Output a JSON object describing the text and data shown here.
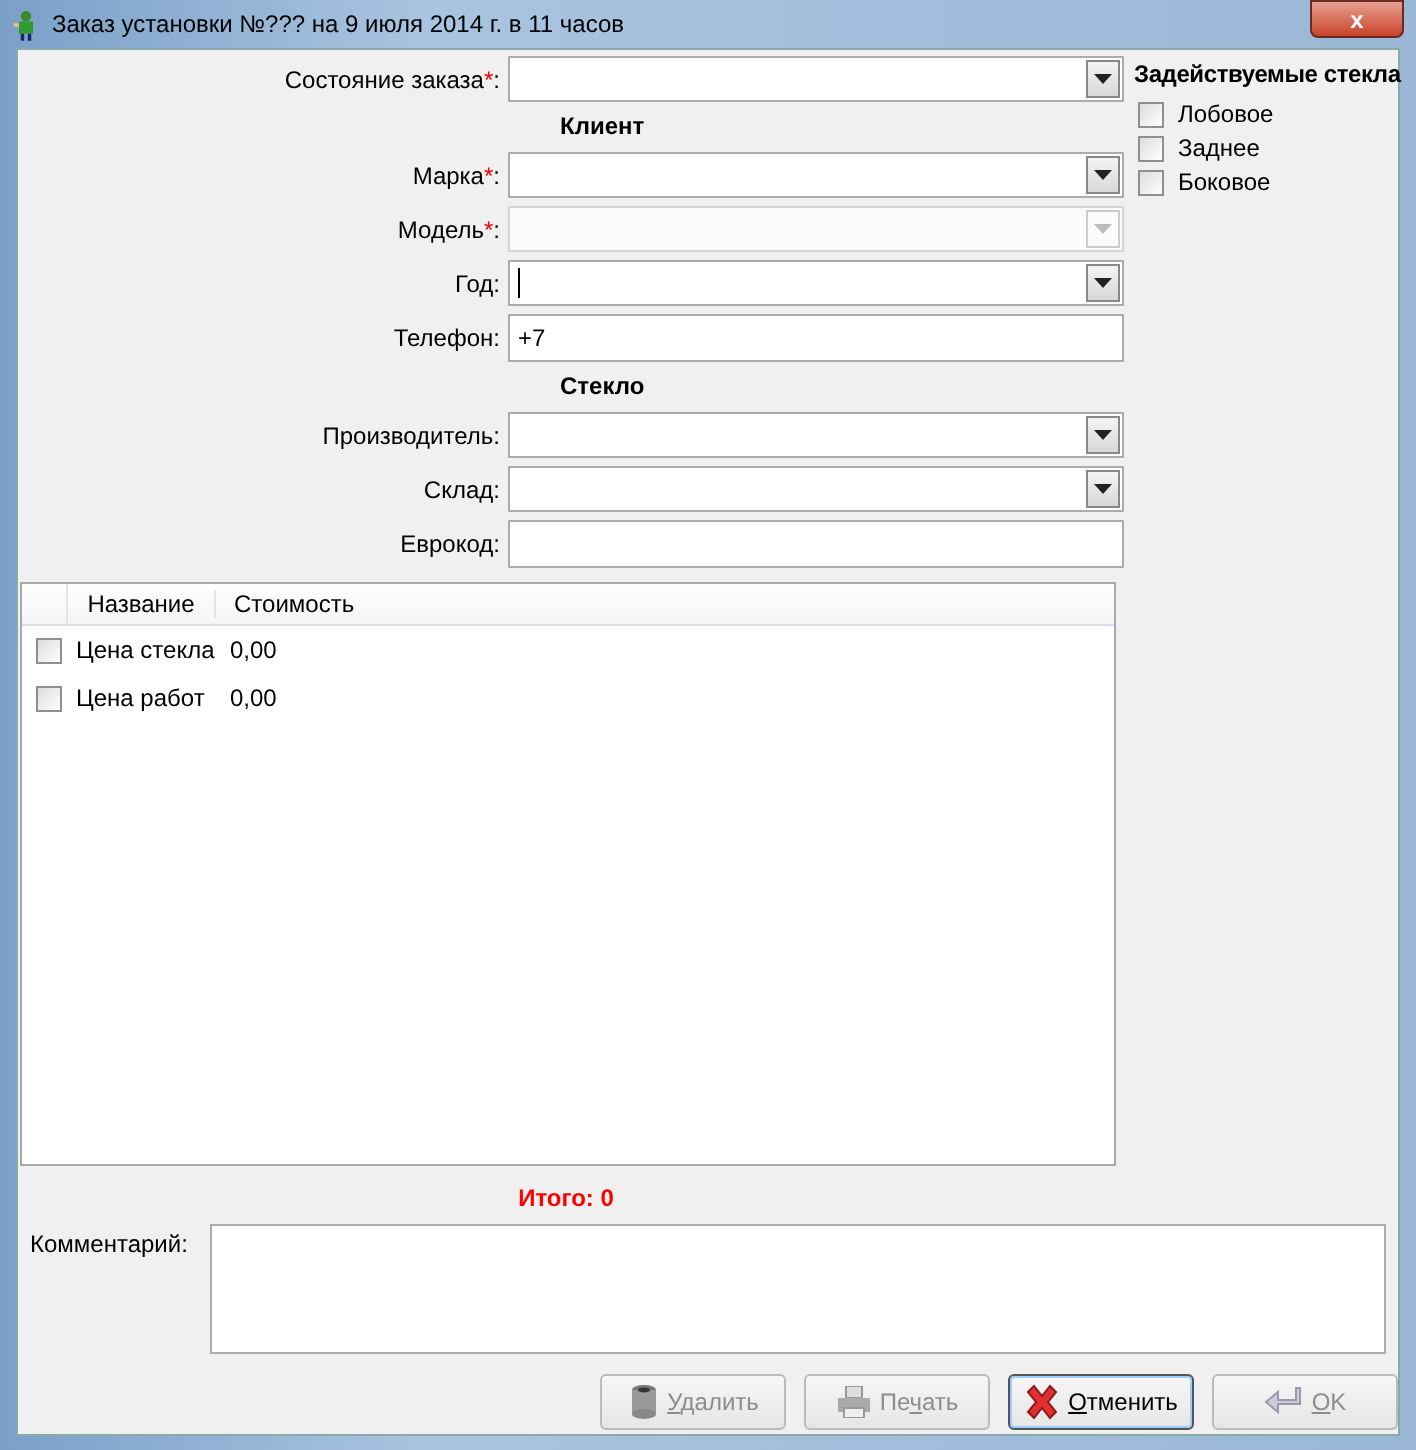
{
  "window": {
    "title": "Заказ установки №??? на 9 июля 2014 г. в 11 часов",
    "close": "x"
  },
  "form": [
    {
      "kind": "combo",
      "label": "Состояние заказа",
      "mark": "*",
      "suffix": ":",
      "disabled": false
    },
    {
      "kind": "heading",
      "label": "Клиент"
    },
    {
      "kind": "combo",
      "label": "Марка",
      "mark": "*",
      "suffix": ":",
      "disabled": false
    },
    {
      "kind": "combo",
      "label": "Модель",
      "mark": "*",
      "suffix": ":",
      "disabled": true
    },
    {
      "kind": "combo",
      "label": "Год",
      "suffix": ":",
      "disabled": false,
      "caret": true
    },
    {
      "kind": "text",
      "label": "Телефон",
      "suffix": ":",
      "value": "+7"
    },
    {
      "kind": "heading",
      "label": "Стекло"
    },
    {
      "kind": "combo",
      "label": "Производитель",
      "suffix": ":",
      "disabled": false
    },
    {
      "kind": "combo",
      "label": "Склад",
      "suffix": ":",
      "disabled": false
    },
    {
      "kind": "text",
      "label": "Еврокод",
      "suffix": ":"
    }
  ],
  "glasses": {
    "title": "Задействуемые стекла",
    "items": [
      {
        "label": "Лобовое",
        "checked": false
      },
      {
        "label": "Заднее",
        "checked": false
      },
      {
        "label": "Боковое",
        "checked": false
      }
    ]
  },
  "table": {
    "columns": [
      "Название",
      "Стоимость"
    ],
    "rows": [
      {
        "checked": false,
        "name": "Цена стекла",
        "cost": "0,00"
      },
      {
        "checked": false,
        "name": "Цена работ",
        "cost": "0,00"
      }
    ]
  },
  "total": "Итого: 0",
  "comment": {
    "label": "Комментарий:"
  },
  "buttons": [
    {
      "kind": "delete",
      "hot": "У",
      "after": "далить",
      "disabled": true,
      "focused": false
    },
    {
      "kind": "print",
      "before": "Пе",
      "hot": "ч",
      "after": "ать",
      "disabled": true,
      "focused": false
    },
    {
      "kind": "cancel",
      "hot": "О",
      "after": "тменить",
      "disabled": false,
      "focused": true
    },
    {
      "kind": "ok",
      "hot": "O",
      "after": "K",
      "disabled": true,
      "focused": false
    }
  ]
}
